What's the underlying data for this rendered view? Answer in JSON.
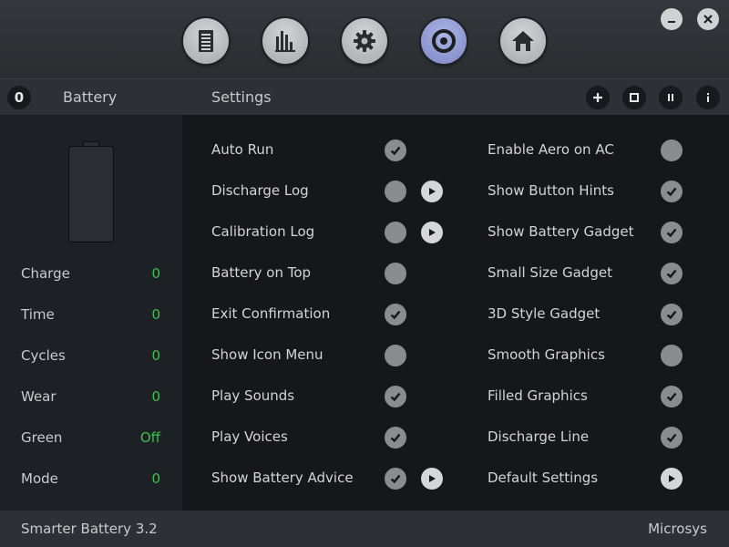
{
  "nav": {
    "buttons": [
      {
        "icon": "document-icon",
        "active": false
      },
      {
        "icon": "bar-chart-icon",
        "active": false
      },
      {
        "icon": "gear-icon",
        "active": false
      },
      {
        "icon": "target-icon",
        "active": true
      },
      {
        "icon": "home-icon",
        "active": false
      }
    ]
  },
  "window": {
    "minimize_icon": "minimize-icon",
    "close_icon": "close-icon"
  },
  "header": {
    "count": "0",
    "left_title": "Battery",
    "right_title": "Settings",
    "tools": [
      "plus-icon",
      "stop-icon",
      "pause-icon",
      "info-icon"
    ]
  },
  "stats": [
    {
      "label": "Charge",
      "value": "0"
    },
    {
      "label": "Time",
      "value": "0"
    },
    {
      "label": "Cycles",
      "value": "0"
    },
    {
      "label": "Wear",
      "value": "0"
    },
    {
      "label": "Green",
      "value": "Off"
    },
    {
      "label": "Mode",
      "value": "0"
    }
  ],
  "settings_left": [
    {
      "label": "Auto Run",
      "checked": true,
      "play": false
    },
    {
      "label": "Discharge Log",
      "checked": false,
      "play": true
    },
    {
      "label": "Calibration Log",
      "checked": false,
      "play": true
    },
    {
      "label": "Battery on Top",
      "checked": false,
      "play": false
    },
    {
      "label": "Exit Confirmation",
      "checked": true,
      "play": false
    },
    {
      "label": "Show Icon Menu",
      "checked": false,
      "play": false
    },
    {
      "label": "Play Sounds",
      "checked": true,
      "play": false
    },
    {
      "label": "Play Voices",
      "checked": true,
      "play": false
    },
    {
      "label": "Show Battery Advice",
      "checked": true,
      "play": true
    }
  ],
  "settings_right": [
    {
      "label": "Enable Aero on AC",
      "checked": false,
      "play": false
    },
    {
      "label": "Show Button Hints",
      "checked": true,
      "play": false
    },
    {
      "label": "Show Battery Gadget",
      "checked": true,
      "play": false
    },
    {
      "label": "Small Size Gadget",
      "checked": true,
      "play": false
    },
    {
      "label": "3D Style Gadget",
      "checked": true,
      "play": false
    },
    {
      "label": "Smooth Graphics",
      "checked": false,
      "play": false
    },
    {
      "label": "Filled Graphics",
      "checked": true,
      "play": false
    },
    {
      "label": "Discharge Line",
      "checked": true,
      "play": false
    },
    {
      "label": "Default Settings",
      "checked": null,
      "play": true
    }
  ],
  "footer": {
    "app_name": "Smarter Battery 3.2",
    "vendor": "Microsys"
  },
  "colors": {
    "accent_green": "#39c24a",
    "active_nav": "#8c97d4",
    "toggle_gray": "#8a8d90"
  }
}
